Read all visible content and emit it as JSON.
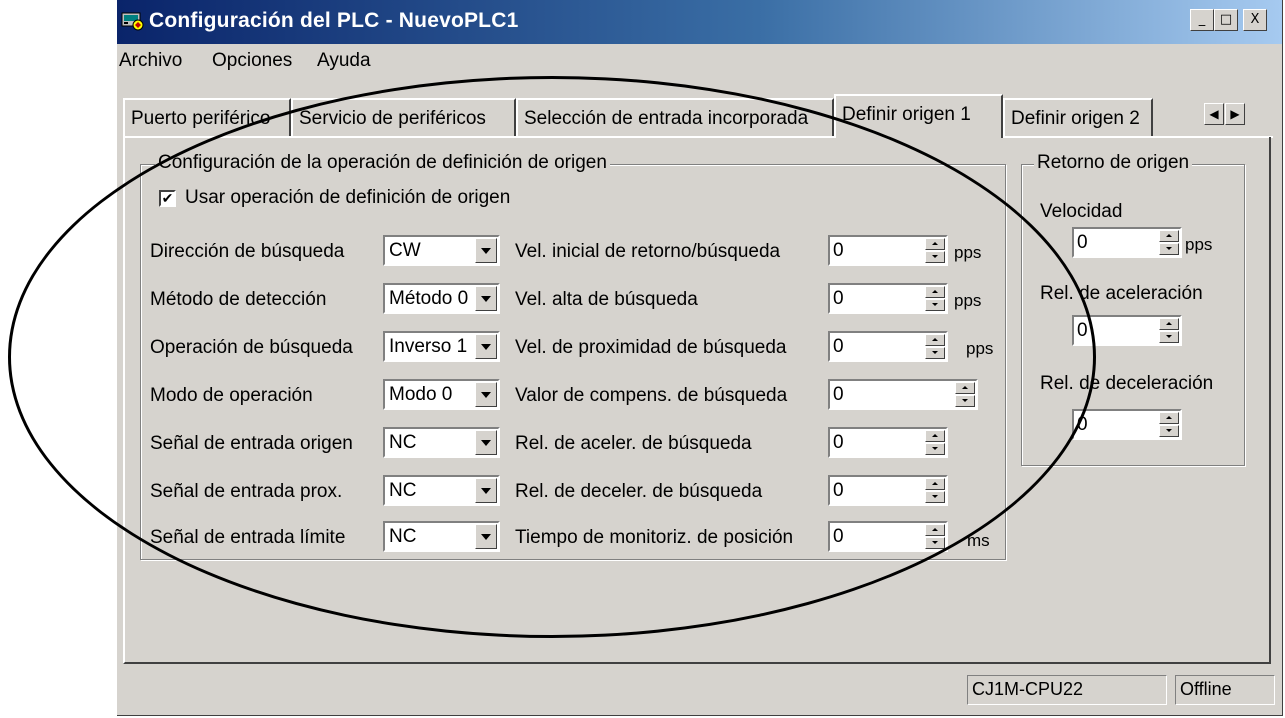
{
  "window": {
    "title": "Configuración del PLC - NuevoPLC1",
    "icon": "plc-config-icon",
    "controls": {
      "minimize": "_",
      "maximize": "□",
      "close": "X"
    }
  },
  "menu": {
    "items": [
      "Archivo",
      "Opciones",
      "Ayuda"
    ]
  },
  "tabs": {
    "items": [
      "Puerto periférico",
      "Servicio de periféricos",
      "Selección de entrada incorporada",
      "Definir origen 1",
      "Definir origen 2"
    ],
    "active": "Definir origen 1",
    "scroll_left": "◀",
    "scroll_right": "▶"
  },
  "origin_group": {
    "title": "Configuración de la operación de definición de origen",
    "use_checkbox": {
      "label": "Usar operación de definición de origen",
      "checked": true,
      "mark": "✔"
    },
    "left_fields": [
      {
        "label": "Dirección de búsqueda",
        "value": "CW"
      },
      {
        "label": "Método de detección",
        "value": "Método 0"
      },
      {
        "label": "Operación de búsqueda",
        "value": "Inverso 1"
      },
      {
        "label": "Modo de operación",
        "value": "Modo 0"
      },
      {
        "label": "Señal de entrada origen",
        "value": "NC"
      },
      {
        "label": "Señal de entrada prox.",
        "value": "NC"
      },
      {
        "label": "Señal de entrada límite",
        "value": "NC"
      }
    ],
    "right_fields": [
      {
        "label": "Vel. inicial de retorno/búsqueda",
        "value": "0",
        "unit": "pps"
      },
      {
        "label": "Vel. alta de búsqueda",
        "value": "0",
        "unit": "pps"
      },
      {
        "label": "Vel. de proximidad de búsqueda",
        "value": "0",
        "unit": "pps"
      },
      {
        "label": "Valor de compens. de búsqueda",
        "value": "0",
        "unit": ""
      },
      {
        "label": "Rel. de aceler. de búsqueda",
        "value": "0",
        "unit": ""
      },
      {
        "label": "Rel. de deceler. de búsqueda",
        "value": "0",
        "unit": ""
      },
      {
        "label": "Tiempo de monitoriz. de posición",
        "value": "0",
        "unit": "ms"
      }
    ]
  },
  "return_group": {
    "title": "Retorno de origen",
    "speed_label": "Velocidad",
    "speed_value": "0",
    "speed_unit": "pps",
    "accel_label": "Rel. de aceleración",
    "accel_value": "0",
    "decel_label": "Rel. de deceleración",
    "decel_value": "0"
  },
  "status": {
    "cpu": "CJ1M-CPU22",
    "mode": "Offline"
  }
}
